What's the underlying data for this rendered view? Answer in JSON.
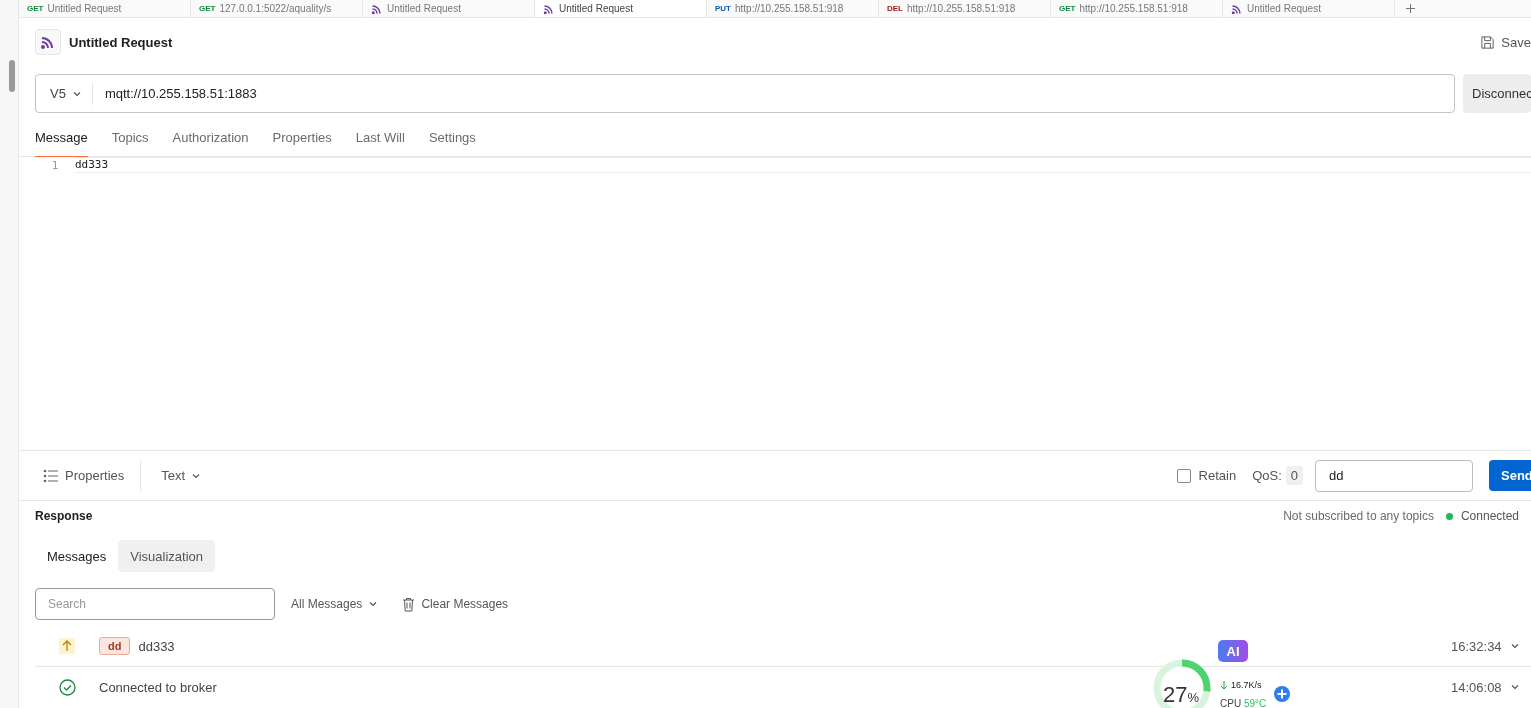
{
  "tabs": [
    {
      "kind": "http",
      "method": "GET",
      "color": "#0b8a3e",
      "label": "Untitled Request",
      "selected": false
    },
    {
      "kind": "http",
      "method": "GET",
      "color": "#0b8a3e",
      "label": "127.0.0.1:5022/aquality/s",
      "selected": false
    },
    {
      "kind": "mqtt",
      "label": "Untitled Request",
      "selected": false
    },
    {
      "kind": "mqtt",
      "label": "Untitled Request",
      "selected": true
    },
    {
      "kind": "http",
      "method": "PUT",
      "color": "#0b5cad",
      "label": "http://10.255.158.51:918",
      "selected": false
    },
    {
      "kind": "http",
      "method": "DEL",
      "color": "#8e1a10",
      "label": "http://10.255.158.51:918",
      "selected": false
    },
    {
      "kind": "http",
      "method": "GET",
      "color": "#0b8a3e",
      "label": "http://10.255.158.51:918",
      "selected": false
    },
    {
      "kind": "mqtt",
      "label": "Untitled Request",
      "selected": false
    }
  ],
  "request": {
    "title": "Untitled Request",
    "save": "Save"
  },
  "url_bar": {
    "version": "V5",
    "url": "mqtt://10.255.158.51:1883",
    "button": "Disconnec"
  },
  "request_tabs": [
    {
      "label": "Message",
      "selected": true
    },
    {
      "label": "Topics",
      "selected": false
    },
    {
      "label": "Authorization",
      "selected": false
    },
    {
      "label": "Properties",
      "selected": false
    },
    {
      "label": "Last Will",
      "selected": false
    },
    {
      "label": "Settings",
      "selected": false
    }
  ],
  "editor": {
    "lines": [
      {
        "number": "1",
        "text": "dd333"
      }
    ]
  },
  "send_bar": {
    "properties": "Properties",
    "format": "Text",
    "retain": {
      "label": "Retain",
      "checked": false
    },
    "qos_label": "QoS:",
    "qos": "0",
    "topic": "dd",
    "send": "Send"
  },
  "response": {
    "title": "Response",
    "status": "Not subscribed to any topics",
    "connection": {
      "label": "Connected",
      "color": "#1db954"
    },
    "tabs": [
      {
        "label": "Messages",
        "selected": true
      },
      {
        "label": "Visualization",
        "selected": false
      }
    ],
    "search": {
      "placeholder": "Search"
    },
    "filter": "All Messages",
    "clear": "Clear Messages",
    "messages": [
      {
        "kind": "sent",
        "topic": "dd",
        "text": "dd333",
        "time": "16:32:34"
      },
      {
        "kind": "event",
        "text": "Connected to broker",
        "time": "14:06:08"
      }
    ]
  },
  "system_widget": {
    "ai": "AI",
    "percent": "27",
    "percent_sign": "%",
    "speed": "16.7K/s",
    "cpu_label": "CPU",
    "cpu_temp": "59°C",
    "level": 0.27
  }
}
